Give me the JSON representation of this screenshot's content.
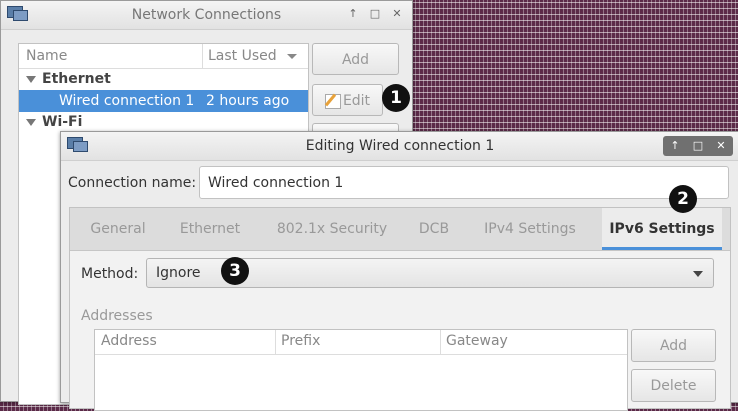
{
  "network_window": {
    "title": "Network Connections",
    "columns": {
      "name": "Name",
      "last_used": "Last Used"
    },
    "groups": [
      {
        "label": "Ethernet",
        "connections": [
          {
            "name": "Wired connection 1",
            "last_used": "2 hours ago"
          }
        ]
      },
      {
        "label": "Wi-Fi"
      }
    ],
    "buttons": {
      "add": "Add",
      "edit": "Edit"
    }
  },
  "editor_window": {
    "title": "Editing Wired connection 1",
    "connection_name_label": "Connection name:",
    "connection_name_value": "Wired connection 1",
    "tabs": [
      "General",
      "Ethernet",
      "802.1x Security",
      "DCB",
      "IPv4 Settings",
      "IPv6 Settings"
    ],
    "active_tab": "IPv6 Settings",
    "method_label": "Method:",
    "method_value": "Ignore",
    "addresses_label": "Addresses",
    "address_columns": [
      "Address",
      "Prefix",
      "Gateway"
    ],
    "buttons": {
      "add": "Add",
      "delete": "Delete"
    }
  },
  "callouts": [
    "1",
    "2",
    "3"
  ],
  "colors": {
    "selection": "#4a90d9",
    "tab_underline": "#4a90d9",
    "desktop": "#5b2a48"
  }
}
